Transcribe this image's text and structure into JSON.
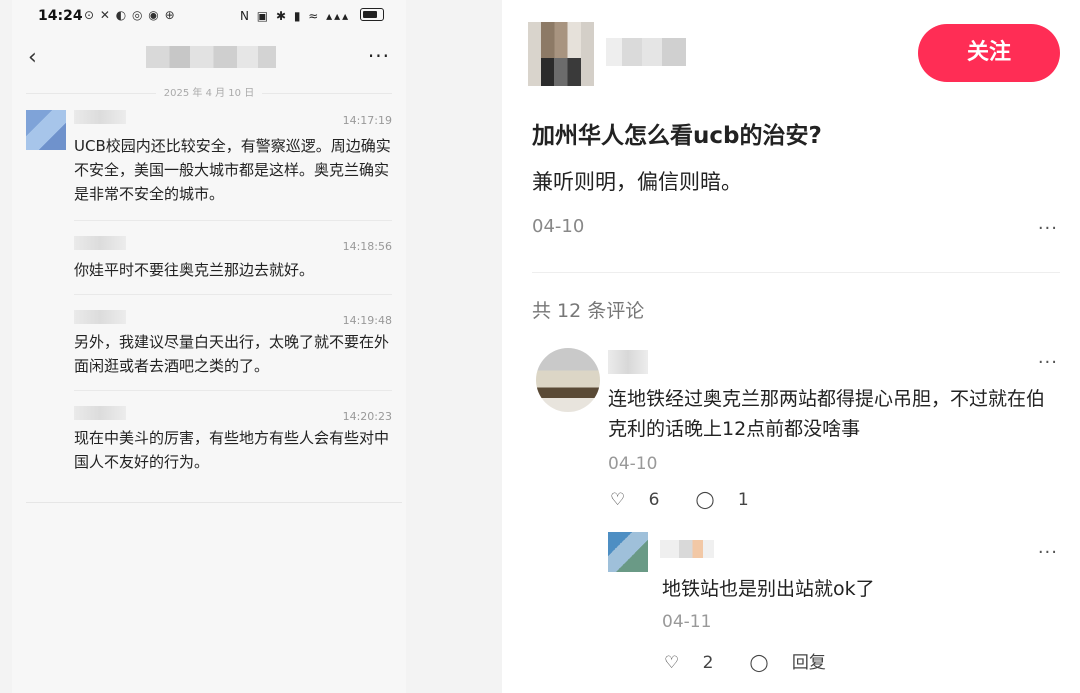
{
  "phone": {
    "status_time": "14:24",
    "status_icons_left": "⊙ ✕ ◐ ◎ ◉ ⊕",
    "status_icons_right": "N ▣ ✱ ▮ ≈ ▴▴▴",
    "date_divider": "2025 年 4 月 10 日",
    "messages": [
      {
        "time": "14:17:19",
        "text": "UCB校园内还比较安全，有警察巡逻。周边确实不安全，美国一般大城市都是这样。奥克兰确实是非常不安全的城市。"
      },
      {
        "time": "14:18:56",
        "text": "你娃平时不要往奥克兰那边去就好。"
      },
      {
        "time": "14:19:48",
        "text": "另外，我建议尽量白天出行，太晚了就不要在外面闲逛或者去酒吧之类的了。"
      },
      {
        "time": "14:20:23",
        "text": "现在中美斗的厉害，有些地方有些人会有些对中国人不友好的行为。"
      }
    ]
  },
  "post": {
    "follow_label": "关注",
    "title": "加州华人怎么看ucb的治安?",
    "body": "兼听则明，偏信则暗。",
    "date": "04-10",
    "more": "···",
    "comment_count": "共 12 条评论",
    "comment": {
      "text": "连地铁经过奥克兰那两站都得提心吊胆，不过就在伯克利的话晚上12点前都没啥事",
      "date": "04-10",
      "likes": "6",
      "replies": "1"
    },
    "reply": {
      "text": "地铁站也是别出站就ok了",
      "date": "04-11",
      "likes": "2",
      "reply_label": "回复"
    }
  }
}
